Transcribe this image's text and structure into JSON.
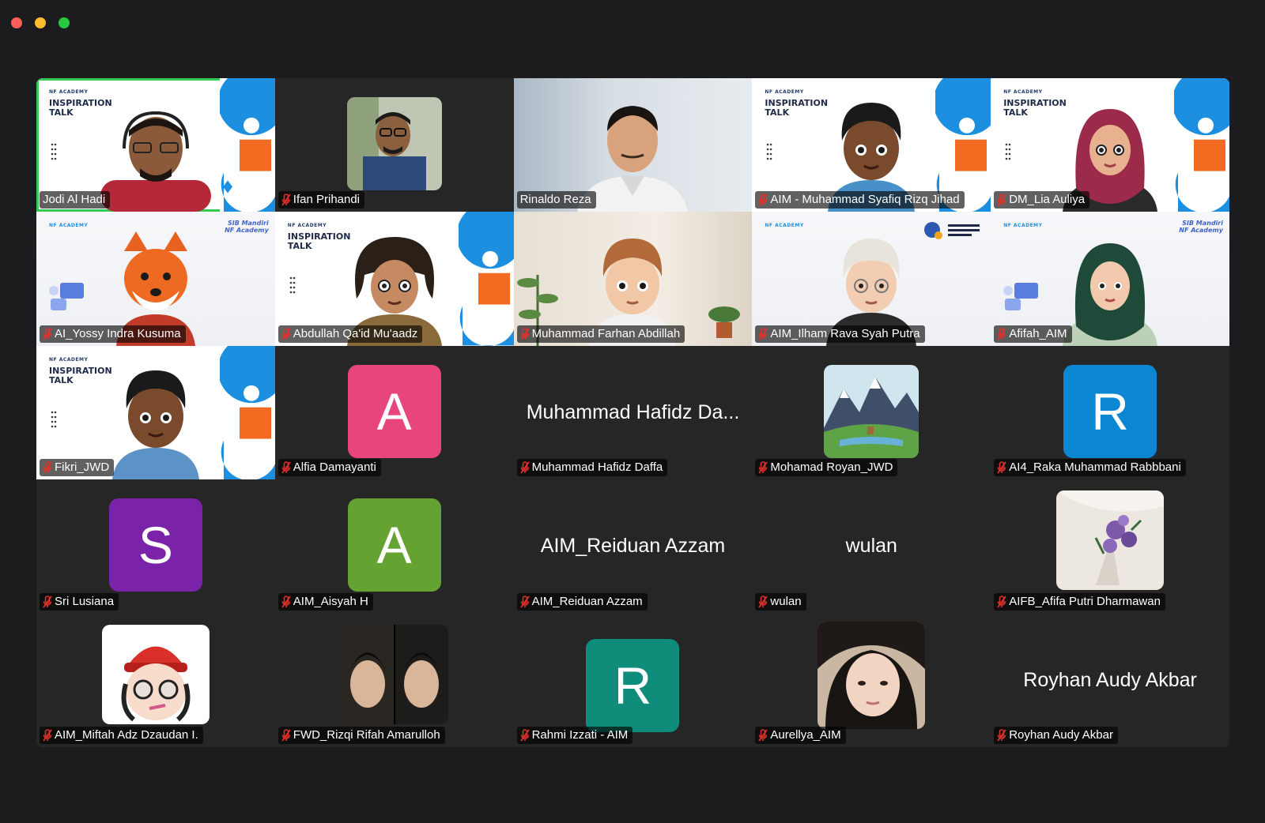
{
  "participants": [
    {
      "name": "Jodi Al Hadi",
      "muted": false,
      "active": true
    },
    {
      "name": "Ifan Prihandi",
      "muted": true
    },
    {
      "name": "Rinaldo Reza",
      "muted": false
    },
    {
      "name": "AIM - Muhammad Syafiq Rizq Jihad",
      "muted": true
    },
    {
      "name": "DM_Lia Auliya",
      "muted": true
    },
    {
      "name": "AI_Yossy Indra Kusuma",
      "muted": true
    },
    {
      "name": "Abdullah Qa'id Mu'aadz",
      "muted": true
    },
    {
      "name": "Muhammad Farhan Abdillah",
      "muted": true
    },
    {
      "name": "AIM_Ilham Rava Syah Putra",
      "muted": true
    },
    {
      "name": "Afifah_AIM",
      "muted": true
    },
    {
      "name": "Fikri_JWD",
      "muted": true
    },
    {
      "name": "Alfia Damayanti",
      "muted": true,
      "avatar_letter": "A",
      "avatar_color": "#e8457f"
    },
    {
      "name": "Muhammad Hafidz Daffa",
      "muted": true,
      "display_name": "Muhammad Hafidz Da..."
    },
    {
      "name": "Mohamad Royan_JWD",
      "muted": true
    },
    {
      "name": "AI4_Raka Muhammad Rabbbani",
      "muted": true,
      "avatar_letter": "R",
      "avatar_color": "#0b86d3"
    },
    {
      "name": "Sri Lusiana",
      "muted": true,
      "avatar_letter": "S",
      "avatar_color": "#7a22a8"
    },
    {
      "name": "AIM_Aisyah H",
      "muted": true,
      "avatar_letter": "A",
      "avatar_color": "#64a232"
    },
    {
      "name": "AIM_Reiduan Azzam",
      "muted": true,
      "display_name": "AIM_Reiduan Azzam"
    },
    {
      "name": "wulan",
      "muted": true,
      "display_name": "wulan"
    },
    {
      "name": "AIFB_Afifa Putri Dharmawan",
      "muted": true
    },
    {
      "name": "AIM_Miftah Adz Dzaudan I.",
      "muted": true
    },
    {
      "name": "FWD_Rizqi Rifah Amarulloh",
      "muted": true
    },
    {
      "name": "Rahmi Izzati - AIM",
      "muted": true,
      "avatar_letter": "R",
      "avatar_color": "#108c7a"
    },
    {
      "name": "Aurellya_AIM",
      "muted": true
    },
    {
      "name": "Royhan Audy Akbar",
      "muted": true,
      "display_name": "Royhan Audy Akbar"
    }
  ],
  "branding": {
    "academy_label": "NF ACADEMY",
    "talk_line1": "INSPIRATION",
    "talk_line2": "TALK",
    "sib_line1": "SIB Mandiri",
    "sib_line2": "NF Academy"
  },
  "colors": {
    "active_speaker": "#37c953",
    "mic_muted": "#e0322b",
    "brand_orange": "#f26b21",
    "brand_blue": "#1d8fe0"
  }
}
